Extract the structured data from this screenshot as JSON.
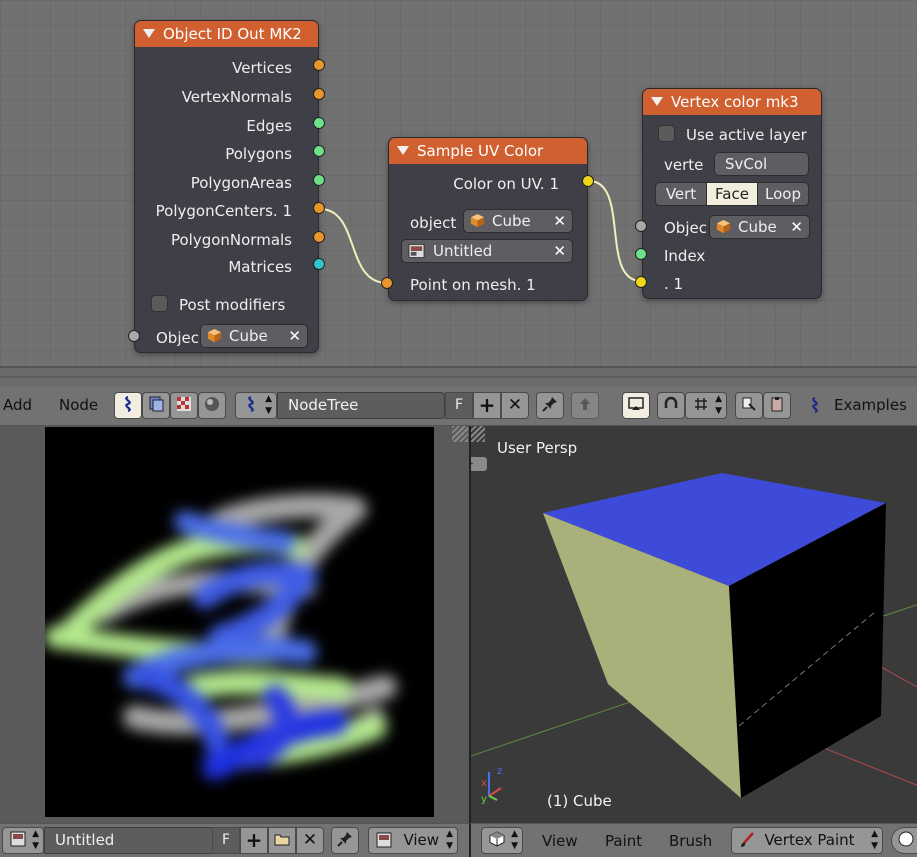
{
  "nodes": {
    "object_id_out": {
      "title": "Object ID Out MK2",
      "outputs": [
        "Vertices",
        "VertexNormals",
        "Edges",
        "Polygons",
        "PolygonAreas",
        "PolygonCenters. 1",
        "PolygonNormals",
        "Matrices"
      ],
      "post_modifiers_label": "Post modifiers",
      "object_label": "Objec",
      "object_value": "Cube"
    },
    "sample_uv": {
      "title": "Sample UV Color",
      "output": "Color on UV. 1",
      "object_label": "object",
      "object_value": "Cube",
      "image_value": "Untitled",
      "input": "Point on mesh. 1"
    },
    "vertex_color": {
      "title": "Vertex color mk3",
      "use_active_layer_label": "Use active layer",
      "verte_label": "verte",
      "verte_value": "SvCol",
      "modes": [
        "Vert",
        "Face",
        "Loop"
      ],
      "active_mode": "Face",
      "object_label": "Objec",
      "object_value": "Cube",
      "index_label": "Index",
      "input_label": ". 1"
    }
  },
  "node_header": {
    "add": "Add",
    "node": "Node",
    "tree_name": "NodeTree",
    "fake_user": "F",
    "examples": "Examples"
  },
  "image_editor": {
    "image_name": "Untitled",
    "fake_user": "F",
    "view_menu": "View"
  },
  "viewport": {
    "view_label": "User Persp",
    "object_label": "(1) Cube",
    "menus": [
      "View",
      "Paint",
      "Brush"
    ],
    "mode": "Vertex Paint",
    "colors": {
      "top_face": "#3d4bd8",
      "front_face": "#a9b07a",
      "side_face": "#000000",
      "background": "#3a3a3a"
    }
  },
  "colors": {
    "node_header": "#d06030",
    "node_body": "#3f4047",
    "active_button": "#f1ede0"
  }
}
